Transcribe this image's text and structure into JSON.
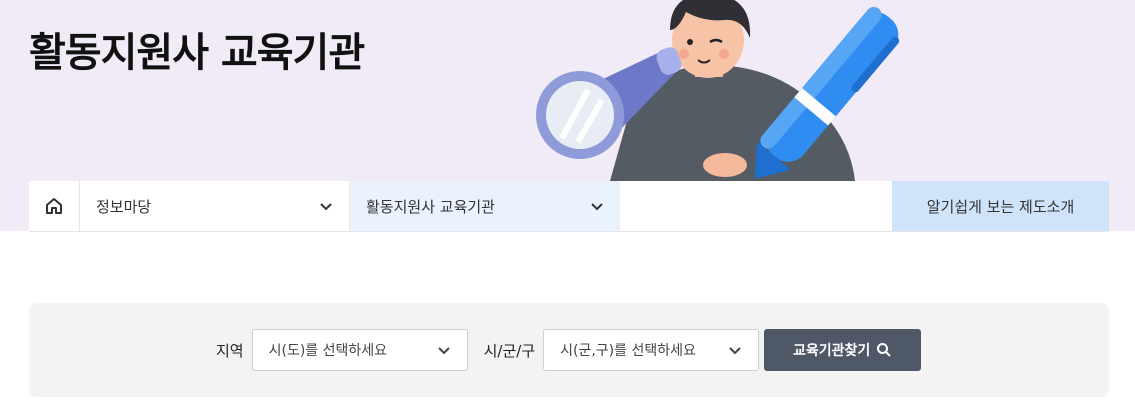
{
  "header": {
    "title": "활동지원사 교육기관"
  },
  "nav": {
    "home_icon": "home-icon",
    "menu1": "정보마당",
    "menu2": "활동지원사 교육기관",
    "cta": "알기쉽게 보는 제도소개"
  },
  "search": {
    "region_label": "지역",
    "region_value": "시(도)를 선택하세요",
    "city_label": "시/군/구",
    "city_value": "시(군,구)를 선택하세요",
    "button_label": "교육기관찾기"
  },
  "colors": {
    "hero_bg": "#f1ebf7",
    "active_menu_bg": "#e9f2fd",
    "cta_bg": "#cfe4fb",
    "button_bg": "#4e5866"
  }
}
